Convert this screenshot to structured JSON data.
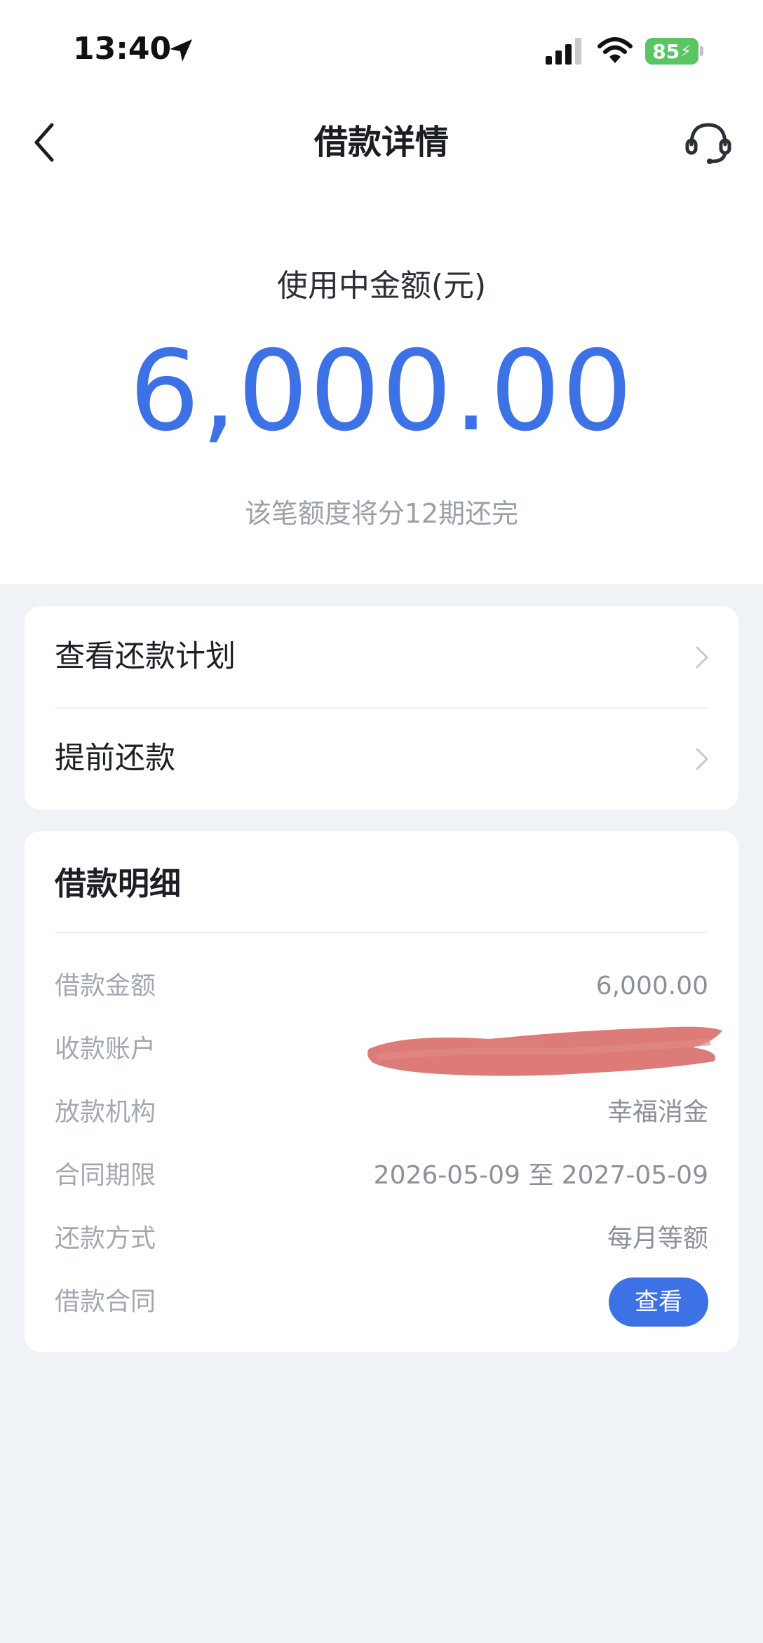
{
  "status_bar": {
    "time": "13:40",
    "battery": "85"
  },
  "nav": {
    "title": "借款详情"
  },
  "hero": {
    "label": "使用中金额(元)",
    "amount": "6,000.00",
    "subtitle": "该笔额度将分12期还完"
  },
  "actions": [
    {
      "label": "查看还款计划"
    },
    {
      "label": "提前还款"
    }
  ],
  "details": {
    "title": "借款明细",
    "rows": [
      {
        "key": "借款金额",
        "value": "6,000.00"
      },
      {
        "key": "收款账户",
        "value": ""
      },
      {
        "key": "放款机构",
        "value": "幸福消金"
      },
      {
        "key": "合同期限",
        "value": "2026-05-09 至 2027-05-09"
      },
      {
        "key": "还款方式",
        "value": "每月等额"
      },
      {
        "key": "借款合同",
        "button": "查看"
      }
    ]
  },
  "colors": {
    "accent": "#3c72e6",
    "page_bg": "#eff2f6",
    "battery": "#5ac563",
    "redaction": "#d9706c"
  },
  "icons": [
    "location-arrow-icon",
    "signal-icon",
    "wifi-icon",
    "battery-icon",
    "back-arrow-icon",
    "customer-service-icon",
    "chevron-right-icon"
  ]
}
